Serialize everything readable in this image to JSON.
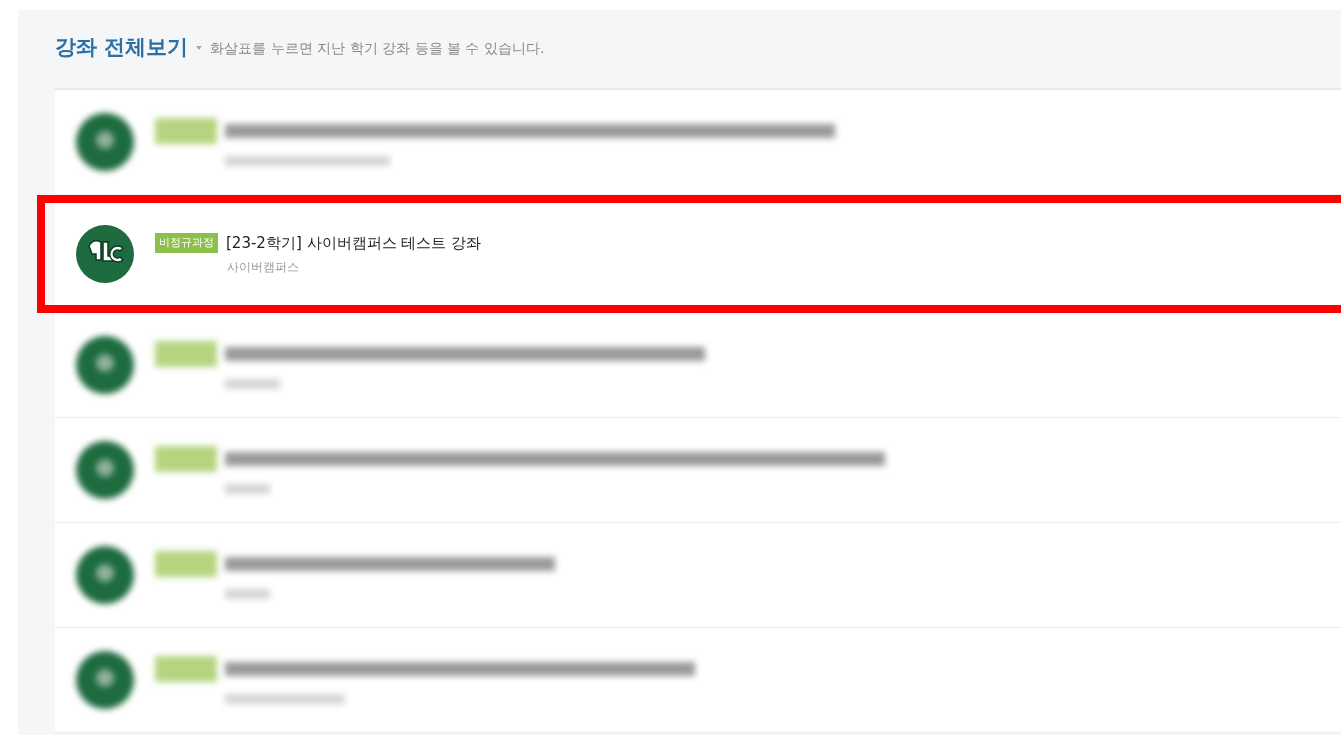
{
  "header": {
    "title": "강좌 전체보기",
    "hint": "화살표를 누르면 지난 학기 강좌 등을 볼 수 있습니다."
  },
  "courses": [
    {
      "kind": "blurred"
    },
    {
      "kind": "course",
      "badge": "비정규과정",
      "title": "[23-2학기] 사이버캠퍼스 테스트 강좌",
      "subtitle": "사이버캠퍼스",
      "highlighted": true
    },
    {
      "kind": "blurred"
    },
    {
      "kind": "blurred"
    },
    {
      "kind": "blurred"
    },
    {
      "kind": "blurred"
    }
  ]
}
